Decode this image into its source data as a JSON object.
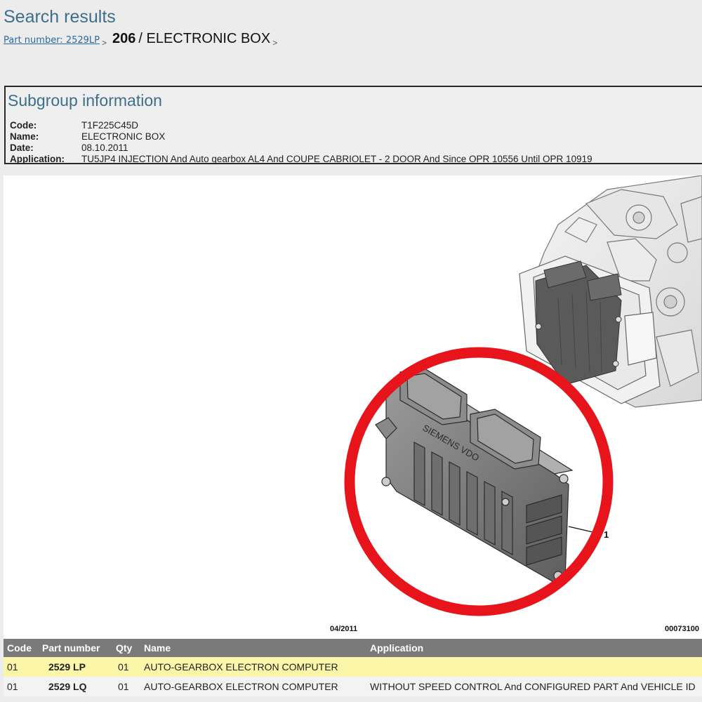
{
  "page": {
    "title": "Search results"
  },
  "breadcrumb": {
    "link_label": "Part number: 2529LP",
    "separator": ">",
    "model": "206",
    "current": "/ ELECTRONIC BOX",
    "trailing_separator": ">"
  },
  "subgroup": {
    "title": "Subgroup information",
    "fields": [
      {
        "label": "Code:",
        "value": "T1F225C45D"
      },
      {
        "label": "Name:",
        "value": "ELECTRONIC BOX"
      },
      {
        "label": "Date:",
        "value": "08.10.2011"
      },
      {
        "label": "Application:",
        "value": "TU5JP4 INJECTION And Auto gearbox AL4 And COUPE CABRIOLET - 2 DOOR And Since OPR 10556 Until OPR 10919"
      }
    ]
  },
  "diagram": {
    "date_stamp": "04/2011",
    "reference": "00073100",
    "callout_number": "1",
    "module_brand_text": "SIEMENS VDO",
    "highlight_color": "#e8141b"
  },
  "table": {
    "headers": {
      "code": "Code",
      "part_number": "Part number",
      "qty": "Qty",
      "name": "Name",
      "application": "Application"
    },
    "rows": [
      {
        "code": "01",
        "part_number": "2529 LP",
        "qty": "01",
        "name": "AUTO-GEARBOX ELECTRON COMPUTER",
        "application": "",
        "highlighted": true
      },
      {
        "code": "01",
        "part_number": "2529 LQ",
        "qty": "01",
        "name": "AUTO-GEARBOX ELECTRON COMPUTER",
        "application": "WITHOUT SPEED CONTROL And CONFIGURED PART And VEHICLE ID",
        "highlighted": false
      }
    ],
    "highlight_color": "#fbf6a8",
    "header_color": "#7a7a7a"
  }
}
